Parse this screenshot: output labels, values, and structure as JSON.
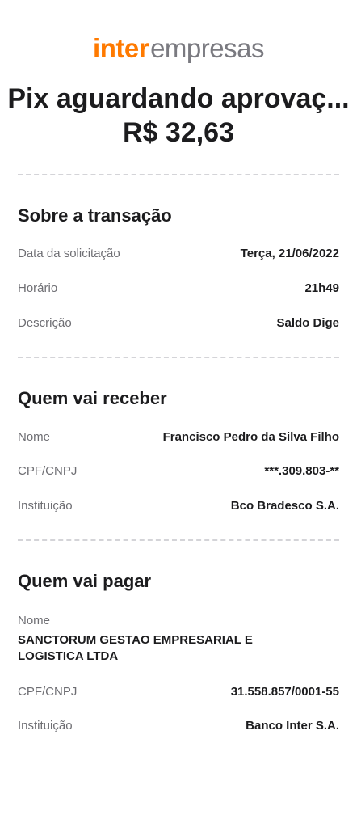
{
  "brand": {
    "part1": "inter",
    "part2": "empresas",
    "accent_color": "#ff7a00"
  },
  "header": {
    "title": "Pix aguardando aprovaç...",
    "amount": "R$ 32,63"
  },
  "transaction": {
    "section_title": "Sobre a transação",
    "date_label": "Data da solicitação",
    "date_value": "Terça, 21/06/2022",
    "time_label": "Horário",
    "time_value": "21h49",
    "description_label": "Descrição",
    "description_value": "Saldo Dige"
  },
  "receiver": {
    "section_title": "Quem vai receber",
    "name_label": "Nome",
    "name_value": "Francisco Pedro da Silva Filho",
    "doc_label": "CPF/CNPJ",
    "doc_value": "***.309.803-**",
    "institution_label": "Instituição",
    "institution_value": "Bco Bradesco S.A."
  },
  "payer": {
    "section_title": "Quem vai pagar",
    "name_label": "Nome",
    "name_value": "SANCTORUM GESTAO EMPRESARIAL E LOGISTICA LTDA",
    "doc_label": "CPF/CNPJ",
    "doc_value": "31.558.857/0001-55",
    "institution_label": "Instituição",
    "institution_value": "Banco Inter S.A."
  }
}
